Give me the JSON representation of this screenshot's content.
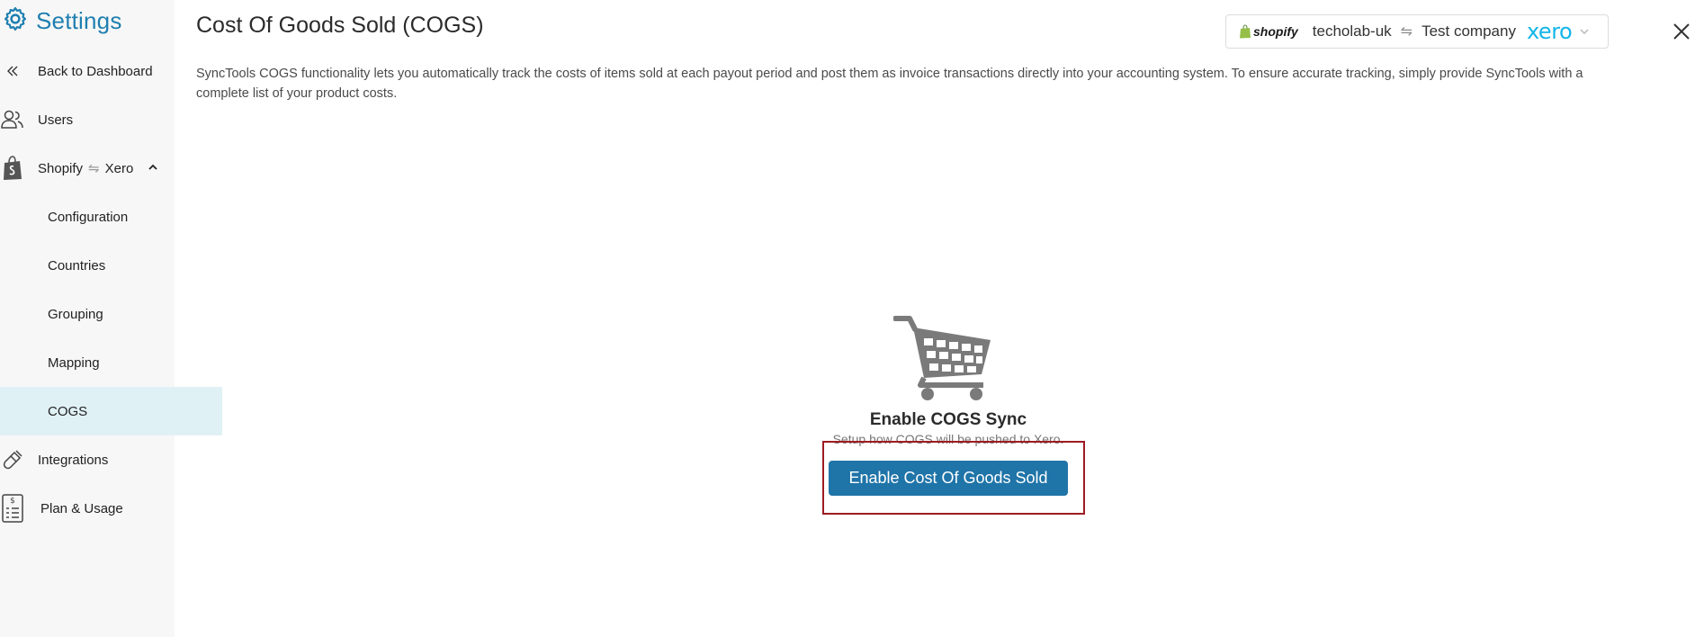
{
  "app": {
    "title": "Settings"
  },
  "sidebar": {
    "back_label": "Back to Dashboard",
    "users_label": "Users",
    "integration": {
      "left": "Shopify",
      "swap_glyph": "⇋",
      "right": "Xero"
    },
    "sub_items": [
      {
        "label": "Configuration"
      },
      {
        "label": "Countries"
      },
      {
        "label": "Grouping"
      },
      {
        "label": "Mapping"
      },
      {
        "label": "COGS"
      }
    ],
    "integrations_label": "Integrations",
    "plan_label": "Plan & Usage"
  },
  "header": {
    "title": "Cost Of Goods Sold (COGS)",
    "description": "SyncTools COGS functionality lets you automatically track the costs of items sold at each payout period and post them as invoice transactions directly into your accounting system. To ensure accurate tracking, simply provide SyncTools with a complete list of your product costs."
  },
  "connection": {
    "source_logo": "shopify",
    "source_name": "techolab-uk",
    "swap_glyph": "⇋",
    "target_name": "Test company",
    "target_logo": "xero"
  },
  "empty_state": {
    "title": "Enable COGS Sync",
    "subtitle": "Setup how COGS will be pushed to Xero.",
    "button_label": "Enable Cost Of Goods Sold"
  },
  "colors": {
    "brand": "#1f7fb0",
    "primary_button": "#1f74a8",
    "active_nav_bg": "#e0f1f6",
    "highlight_border": "#9e1b22",
    "xero": "#13b5ea",
    "shopify_green": "#95bf47"
  }
}
